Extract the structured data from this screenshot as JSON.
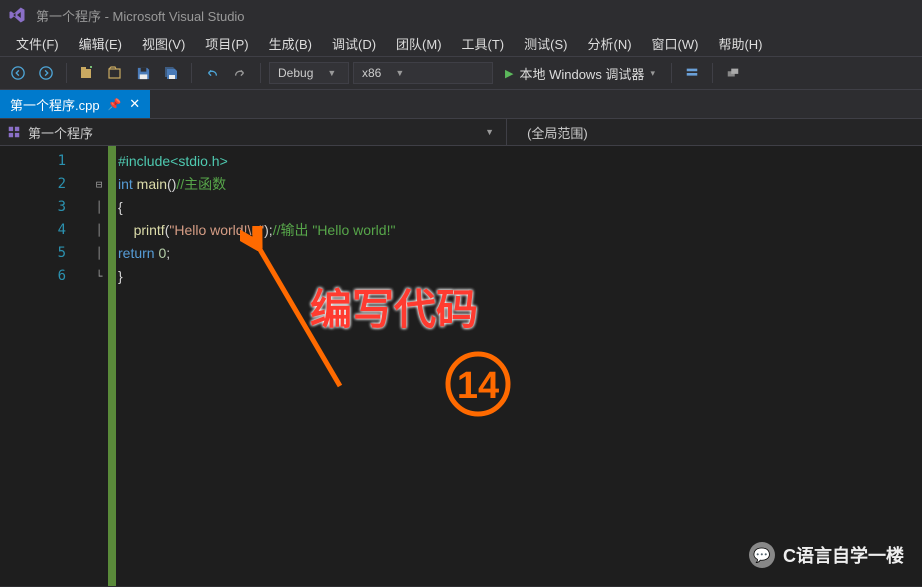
{
  "title": "第一个程序 - Microsoft Visual Studio",
  "menu": {
    "file": "文件(F)",
    "edit": "编辑(E)",
    "view": "视图(V)",
    "project": "项目(P)",
    "build": "生成(B)",
    "debug": "调试(D)",
    "team": "团队(M)",
    "tools": "工具(T)",
    "test": "测试(S)",
    "analyze": "分析(N)",
    "window": "窗口(W)",
    "help": "帮助(H)"
  },
  "toolbar": {
    "config": "Debug",
    "platform": "x86",
    "run_label": "本地 Windows 调试器"
  },
  "tab": {
    "filename": "第一个程序.cpp"
  },
  "nav": {
    "project": "第一个程序",
    "scope": "(全局范围)"
  },
  "code": {
    "lines": [
      {
        "n": "1"
      },
      {
        "n": "2"
      },
      {
        "n": "3"
      },
      {
        "n": "4"
      },
      {
        "n": "5"
      },
      {
        "n": "6"
      }
    ],
    "l1_include": "#include",
    "l1_hdr": "<stdio.h>",
    "l2_int": "int",
    "l2_main": " main",
    "l2_paren": "()",
    "l2_comment": "//主函数",
    "l3_brace": "{",
    "l4_printf": "printf",
    "l4_open": "(",
    "l4_str": "\"Hello world!\\n\"",
    "l4_close": ");",
    "l4_comment": "//输出 \"Hello world!\"",
    "l5_return": "return",
    "l5_zero": " 0",
    "l5_semi": ";",
    "l6_brace": "}"
  },
  "annotation": {
    "text": "编写代码",
    "step": "14"
  },
  "watermark": "C语言自学一楼"
}
